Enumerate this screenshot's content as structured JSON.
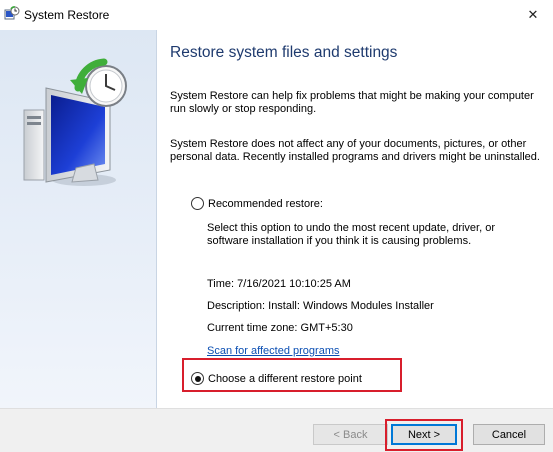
{
  "window": {
    "title": "System Restore",
    "icon": "system-restore-icon",
    "close_glyph": "✕"
  },
  "content": {
    "heading": "Restore system files and settings",
    "paragraph1": "System Restore can help fix problems that might be making your computer run slowly or stop responding.",
    "paragraph2": "System Restore does not affect any of your documents, pictures, or other personal data. Recently installed programs and drivers might be uninstalled."
  },
  "options": {
    "recommended": {
      "label": "Recommended restore:",
      "selected": false,
      "description": "Select this option to undo the most recent update, driver, or software installation if you think it is causing problems.",
      "time": "Time: 7/16/2021 10:10:25 AM",
      "description_line": "Description: Install: Windows Modules Installer",
      "timezone": "Current time zone: GMT+5:30",
      "scan_link": "Scan for affected programs"
    },
    "different": {
      "label": "Choose a different restore point",
      "selected": true
    }
  },
  "buttons": {
    "back": "< Back",
    "back_enabled": false,
    "next": "Next >",
    "cancel": "Cancel"
  },
  "colors": {
    "heading": "#1e3a6e",
    "link": "#0b4fb3",
    "highlight": "#d81e2c",
    "focus": "#0078d7"
  }
}
